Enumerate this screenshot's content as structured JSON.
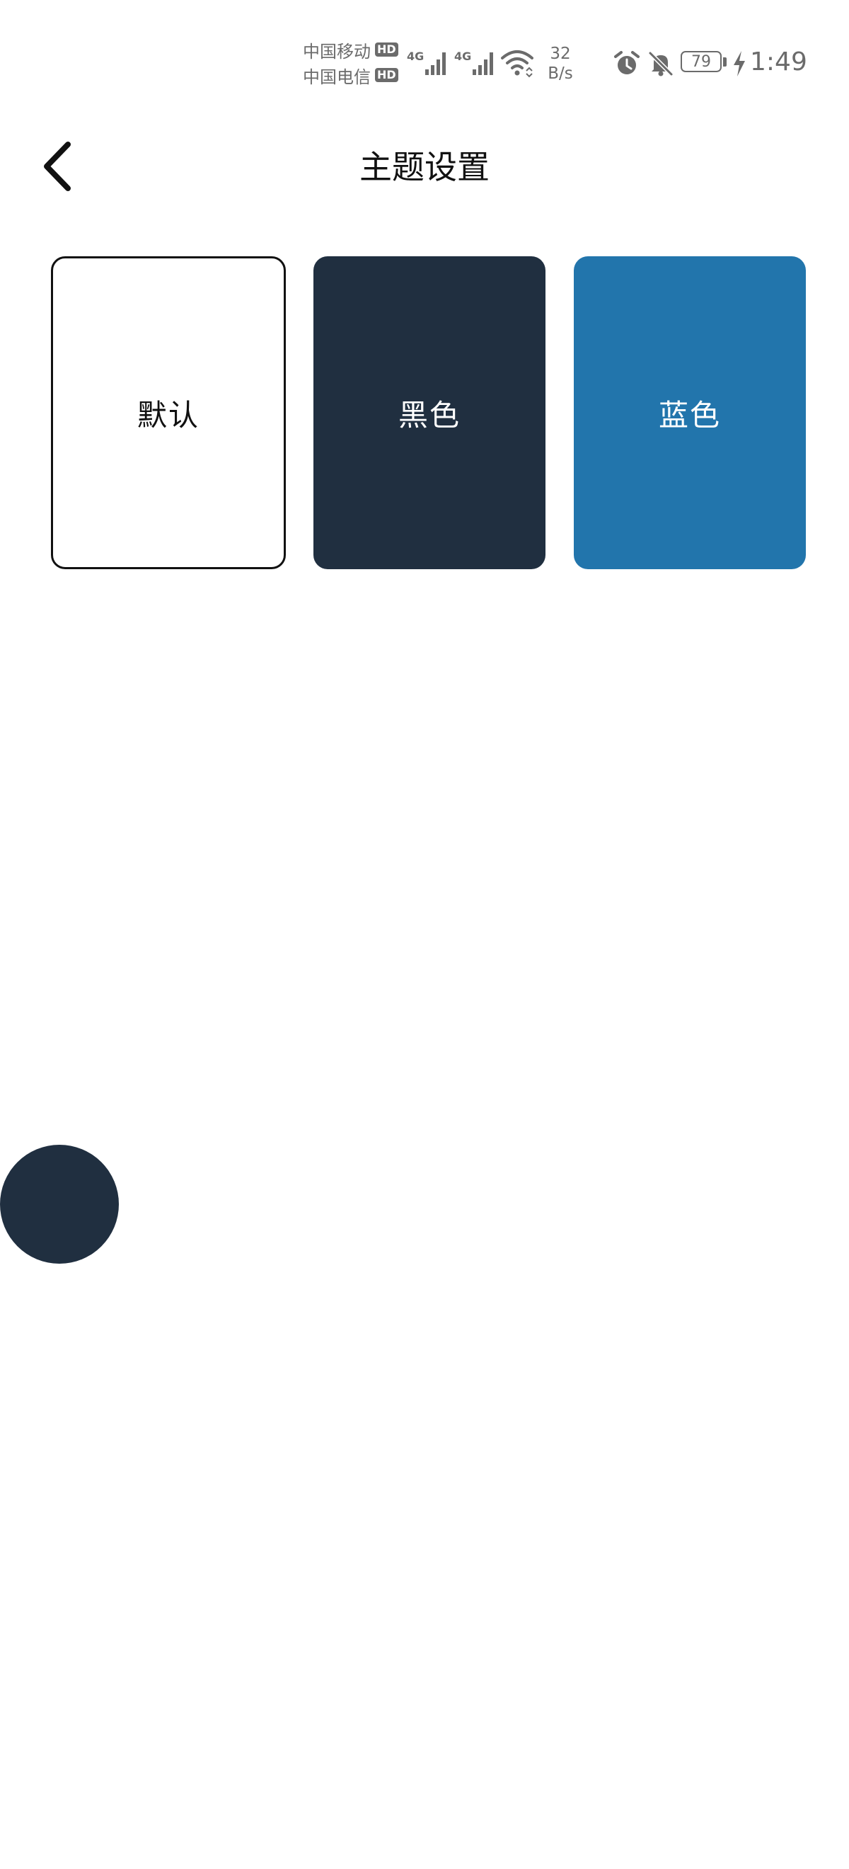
{
  "status_bar": {
    "carrier_1": "中国移动",
    "carrier_2": "中国电信",
    "hd_badge": "HD",
    "network_type": "4G",
    "speed_value": "32",
    "speed_unit": "B/s",
    "battery_level": "79",
    "time": "1:49",
    "icons": [
      "signal-icon",
      "wifi-icon",
      "alarm-icon",
      "bell-off-icon",
      "battery-icon",
      "charging-icon"
    ]
  },
  "header": {
    "title": "主题设置",
    "back_icon": "chevron-left-icon"
  },
  "themes": [
    {
      "label": "默认",
      "color": "#ffffff",
      "text_color": "#111111",
      "border": "#111111"
    },
    {
      "label": "黑色",
      "color": "#202f40",
      "text_color": "#ffffff"
    },
    {
      "label": "蓝色",
      "color": "#2275ac",
      "text_color": "#ffffff"
    }
  ],
  "floating_ball": {
    "color": "#202f40"
  }
}
